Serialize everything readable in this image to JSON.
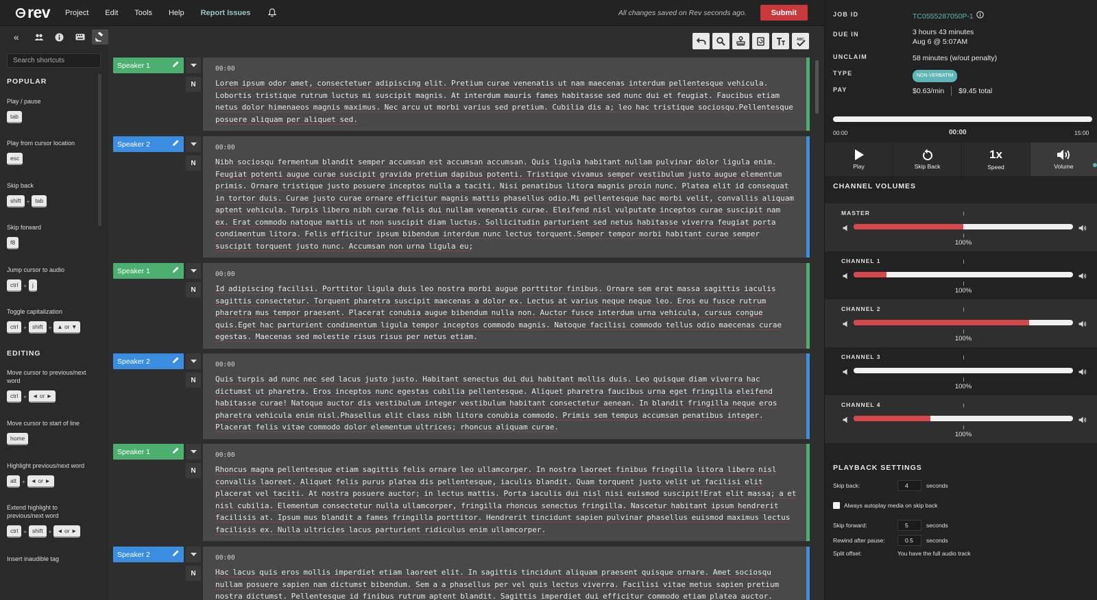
{
  "topbar": {
    "logo": "rev",
    "menu": [
      "Project",
      "Edit",
      "Tools",
      "Help"
    ],
    "report_issues": "Report Issues",
    "save_status": "All changes saved on Rev seconds ago.",
    "submit_label": "Submit"
  },
  "sidebar": {
    "tabs": [
      "collapse-icon",
      "people-icon",
      "info-icon",
      "keyboard-icon",
      "gavel-icon"
    ],
    "search_placeholder": "Search shortcuts",
    "popular_title": "POPULAR",
    "editing_title": "EDITING",
    "popular": [
      {
        "label": "Play / pause",
        "keys": [
          "tab"
        ]
      },
      {
        "label": "Play from cursor location",
        "keys": [
          "esc"
        ]
      },
      {
        "label": "Skip back",
        "keys": [
          "shift",
          "tab"
        ]
      },
      {
        "label": "Skip forward",
        "keys": [
          "f8"
        ]
      },
      {
        "label": "Jump cursor to audio",
        "keys": [
          "ctrl",
          "j"
        ]
      },
      {
        "label": "Toggle capitalization",
        "keys": [
          "ctrl",
          "shift",
          "▲ or ▼"
        ]
      }
    ],
    "editing": [
      {
        "label": "Move cursor to previous/next word",
        "keys": [
          "ctrl",
          "◄ or ►"
        ]
      },
      {
        "label": "Move cursor to start of line",
        "keys": [
          "home"
        ]
      },
      {
        "label": "Highlight previous/next word",
        "keys": [
          "alt",
          "◄ or ►"
        ]
      },
      {
        "label": "Extend highlight to previous/next word",
        "keys": [
          "ctrl",
          "shift",
          "◄ or ►"
        ]
      },
      {
        "label": "Insert inaudible tag",
        "keys": []
      }
    ]
  },
  "segments": [
    {
      "speaker": "Speaker 1",
      "color": "#4cae6f",
      "tag": "N",
      "time": "00:00",
      "text": "Lorem ipsum odor amet, consectetuer adipiscing elit. Pretium curae venenatis ut nam maecenas interdum pellentesque vehicula. Lobortis tristique rutrum luctus mi suscipit magnis. At interdum mauris fames habitasse sed nunc dui et feugiat. Faucibus etiam netus dolor himenaeos magnis maximus. Nec arcu ut morbi varius sed pretium. Cubilia dis a; leo hac tristique sociosqu.Pellentesque posuere aliquam per aliquet sed."
    },
    {
      "speaker": "Speaker 2",
      "color": "#3b8de0",
      "tag": "N",
      "time": "00:00",
      "text": "Nibh sociosqu fermentum blandit semper accumsan est accumsan accumsan. Quis ligula habitant nullam pulvinar dolor ligula enim. Feugiat potenti augue curae suscipit gravida pretium dapibus potenti. Tristique vivamus semper vestibulum justo augue elementum primis. Ornare tristique justo posuere inceptos nulla a taciti. Nisi penatibus litora magnis proin nunc. Platea elit id consequat in tortor duis. Curae justo curae ornare efficitur magnis mattis phasellus odio.Mi pellentesque hac morbi velit, convallis aliquam aptent vehicula. Turpis libero nibh curae felis dui nullam venenatis curae. Eleifend nisl vulputate inceptos curae suscipit nam ex. Erat commodo natoque mattis ut non suscipit diam luctus. Sollicitudin parturient sed netus habitasse viverra feugiat porta condimentum litora. Felis efficitur ipsum bibendum interdum nunc lectus torquent.Semper tempor morbi habitant curae semper suscipit torquent justo nunc. Accumsan non urna ligula eu;"
    },
    {
      "speaker": "Speaker 1",
      "color": "#4cae6f",
      "tag": "N",
      "time": "00:00",
      "text": "Id adipiscing facilisi. Porttitor ligula duis leo nostra morbi augue porttitor finibus. Ornare sem erat massa sagittis iaculis sagittis consectetur. Torquent pharetra suscipit maecenas a dolor ex. Lectus at varius neque neque leo. Eros eu fusce rutrum pharetra mus tempor praesent. Placerat conubia augue bibendum nulla non. Auctor fusce interdum urna vehicula, cursus congue quis.Eget hac parturient condimentum ligula tempor inceptos commodo magnis. Natoque facilisi commodo tellus odio maecenas curae egestas. Maecenas sed molestie risus risus per netus etiam."
    },
    {
      "speaker": "Speaker 2",
      "color": "#3b8de0",
      "tag": "N",
      "time": "00:00",
      "text": "Quis turpis ad nunc nec sed lacus justo justo. Habitant senectus dui dui habitant mollis duis. Leo quisque diam viverra hac dictumst ut pharetra. Eros inceptos nunc egestas cubilia pellentesque. Aliquet pharetra faucibus urna eget fringilla eleifend habitasse curae! Natoque auctor dis vestibulum integer vestibulum habitant consectetur aenean. In blandit fringilla neque eros pharetra vehicula enim nisl.Phasellus elit class nibh litora conubia commodo. Primis sem tempus accumsan penatibus integer. Placerat felis vitae commodo dolor elementum ultrices; rhoncus aliquam curae."
    },
    {
      "speaker": "Speaker 1",
      "color": "#4cae6f",
      "tag": "N",
      "time": "00:00",
      "text": "Rhoncus magna pellentesque etiam sagittis felis ornare leo ullamcorper. In nostra laoreet finibus fringilla litora libero nisl convallis laoreet. Aliquet felis purus platea dis pellentesque, iaculis blandit. Quam torquent justo velit ut facilisi elit placerat vel taciti. At nostra posuere auctor; in lectus mattis. Porta iaculis dui nisl nisi euismod suscipit!Erat elit massa; a et nisl cubilia. Elementum consectetur nulla ullamcorper, fringilla rhoncus senectus fringilla. Nascetur habitant ipsum hendrerit facilisis at. Ipsum mus blandit a fames fringilla porttitor. Hendrerit tincidunt sapien pulvinar phasellus euismod maximus lectus facilisis ex. Nulla ultricies lacus parturient ridiculus enim ullamcorper."
    },
    {
      "speaker": "Speaker 2",
      "color": "#3b8de0",
      "tag": "N",
      "time": "00:00",
      "text": "Hac lacus quis eros mollis imperdiet etiam laoreet elit. In sagittis tincidunt aliquam praesent quisque ornare. Amet sociosqu nullam posuere sapien nam dictumst bibendum. Sem a a phasellus per vel quis lectus viverra. Facilisi vitae metus sapien pretium nostra dictumst. Pellentesque id finibus rutrum aptent blandit. Sagittis imperdiet dui efficitur commodo etiam platea auctor. Ultricies"
    }
  ],
  "job": {
    "job_id_label": "JOB ID",
    "job_id": "TC0555287050P-1",
    "due_label": "DUE IN",
    "due_line1": "3 hours 43 minutes",
    "due_line2": "Aug 6 @ 5:07AM",
    "unclaim_label": "UNCLAIM",
    "unclaim": "58 minutes (w/out penalty)",
    "type_label": "TYPE",
    "type": "NON-VERBATIM",
    "pay_label": "PAY",
    "pay_rate": "$0.63/min",
    "pay_total": "$9.45 total"
  },
  "player": {
    "progress": 0,
    "start": "00:00",
    "current": "00:00",
    "end": "15:00",
    "play": "Play",
    "skip_back": "Skip Back",
    "speed_value": "1x",
    "speed": "Speed",
    "volume": "Volume"
  },
  "channel_volumes": {
    "title": "CHANNEL VOLUMES",
    "channels": [
      {
        "name": "MASTER",
        "level": 0.5,
        "pct": "100%"
      },
      {
        "name": "CHANNEL 1",
        "level": 0.15,
        "pct": "100%"
      },
      {
        "name": "CHANNEL 2",
        "level": 0.8,
        "pct": "100%"
      },
      {
        "name": "CHANNEL 3",
        "level": 0,
        "pct": "100%"
      },
      {
        "name": "CHANNEL 4",
        "level": 0.35,
        "pct": "100%"
      }
    ]
  },
  "playback": {
    "title": "PLAYBACK SETTINGS",
    "skip_back_label": "Skip back:",
    "skip_back_value": "4",
    "skip_back_unit": "seconds",
    "autoplay_label": "Always autoplay media on skip back",
    "skip_forward_label": "Skip forward:",
    "skip_forward_value": "5",
    "skip_forward_unit": "seconds",
    "rewind_label": "Rewind after pause:",
    "rewind_value": "0.5",
    "rewind_unit": "seconds",
    "split_label": "Split offset:",
    "split_value": "You have the full audio track"
  }
}
